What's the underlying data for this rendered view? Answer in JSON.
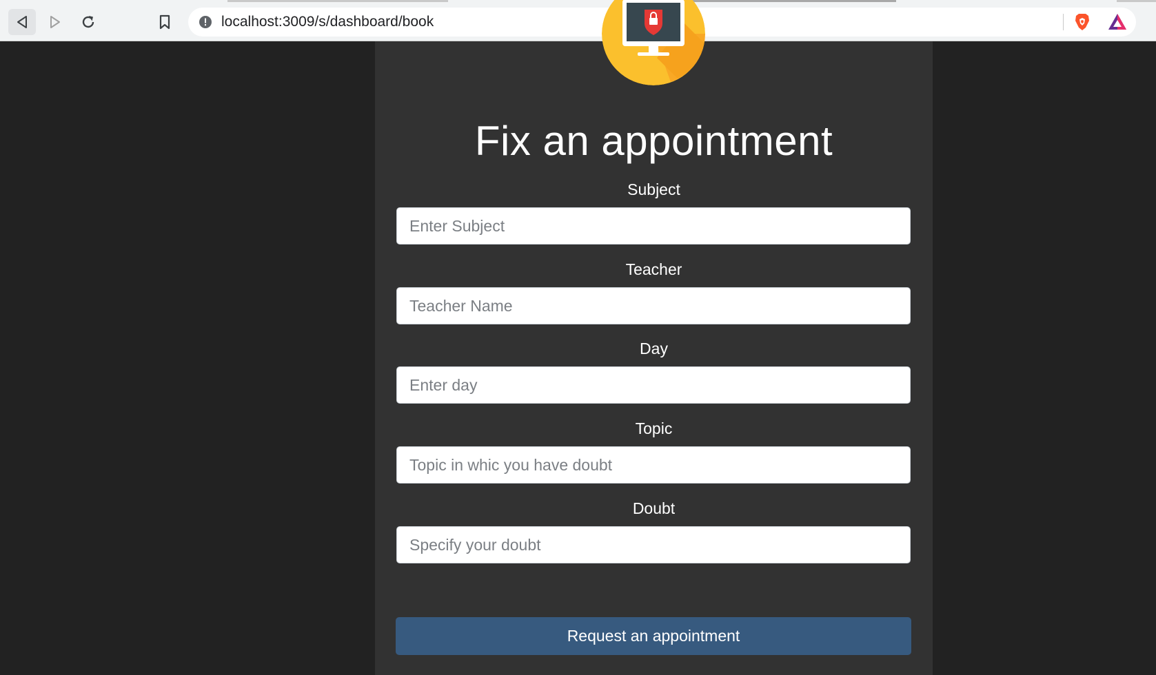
{
  "browser": {
    "url": "localhost:3009/s/dashboard/book"
  },
  "page": {
    "title": "Fix an appointment"
  },
  "form": {
    "fields": [
      {
        "label": "Subject",
        "placeholder": "Enter Subject"
      },
      {
        "label": "Teacher",
        "placeholder": "Teacher Name"
      },
      {
        "label": "Day",
        "placeholder": "Enter day"
      },
      {
        "label": "Topic",
        "placeholder": "Topic in whic you have doubt"
      },
      {
        "label": "Doubt",
        "placeholder": "Specify your doubt"
      }
    ],
    "submit_label": "Request an appointment"
  },
  "colors": {
    "page_background": "#222222",
    "card_background": "#323232",
    "button_primary": "#375a7f",
    "logo_yellow": "#fbc02d",
    "logo_accent": "#e53935"
  },
  "icons": {
    "back": "back-arrow-icon",
    "forward": "forward-arrow-icon",
    "reload": "reload-icon",
    "bookmark": "bookmark-icon",
    "site_info": "info-icon",
    "brave": "brave-shield-icon",
    "rewards": "brave-rewards-icon",
    "logo": "computer-lock-icon"
  }
}
